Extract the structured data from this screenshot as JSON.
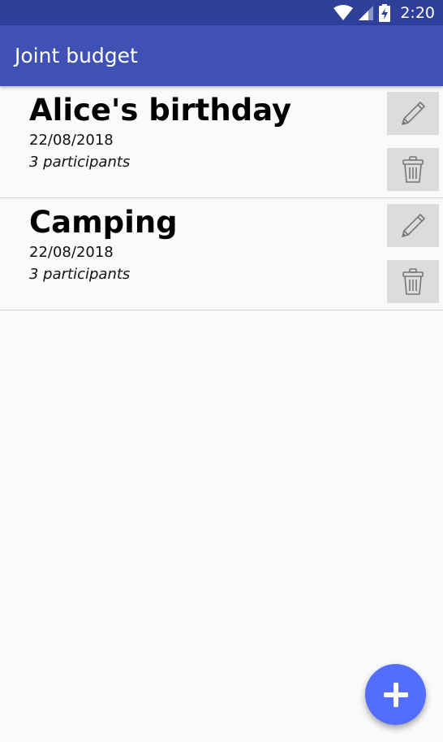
{
  "status_bar": {
    "time": "2:20",
    "icons": [
      "wifi-icon",
      "signal-icon",
      "battery-charging-icon"
    ]
  },
  "app_bar": {
    "title": "Joint budget"
  },
  "events": [
    {
      "name": "Alice's birthday",
      "date": "22/08/2018",
      "participants": "3 participants",
      "edit_icon": "pencil-icon",
      "delete_icon": "trash-icon"
    },
    {
      "name": "Camping",
      "date": "22/08/2018",
      "participants": "3 participants",
      "edit_icon": "pencil-icon",
      "delete_icon": "trash-icon"
    }
  ],
  "fab": {
    "icon": "plus-icon"
  },
  "colors": {
    "status_bar": "#2f3f9a",
    "app_bar": "#3f51b5",
    "fab": "#536dfe",
    "icon_button_bg": "#dcdcdc",
    "background": "#fafafa"
  }
}
